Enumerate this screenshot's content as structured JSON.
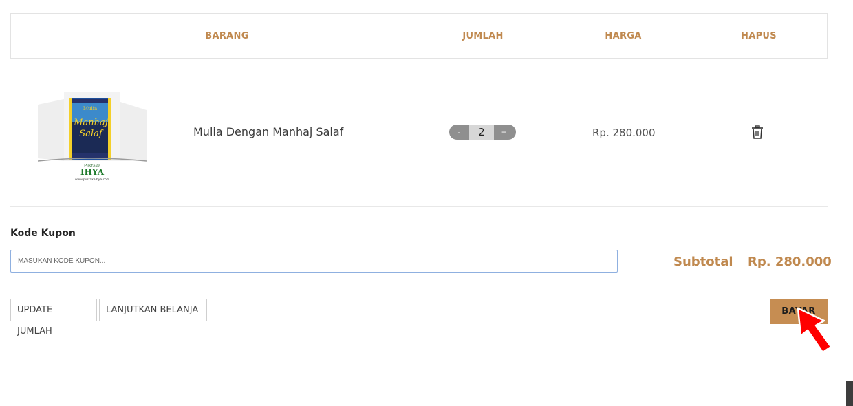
{
  "table": {
    "headers": {
      "item": "BARANG",
      "quantity": "JUMLAH",
      "price": "HARGA",
      "delete": "HAPUS"
    },
    "rows": [
      {
        "name": "Mulia Dengan Manhaj Salaf",
        "quantity": "2",
        "price": "Rp. 280.000",
        "thumb": {
          "title_line1": "Mulia",
          "title_line2": "Manhaj",
          "title_line3": "Salaf",
          "publisher_small": "Pustaka",
          "publisher": "IHYA",
          "website": "www.pustakaihya.com"
        }
      }
    ],
    "qty_minus": "-",
    "qty_plus": "+"
  },
  "coupon": {
    "label": "Kode Kupon",
    "placeholder": "MASUKAN KODE KUPON...",
    "value": ""
  },
  "summary": {
    "subtotal_label": "Subtotal",
    "subtotal_value": "Rp. 280.000"
  },
  "actions": {
    "update_label": "UPDATE JUMLAH",
    "continue_label": "LANJUTKAN BELANJA",
    "pay_label": "BAYAR"
  },
  "colors": {
    "accent": "#c0894f",
    "pay_button": "#c68d52",
    "cursor": "#ff0000"
  },
  "icons": {
    "delete": "trash-icon",
    "pointer": "mouse-pointer-icon"
  }
}
